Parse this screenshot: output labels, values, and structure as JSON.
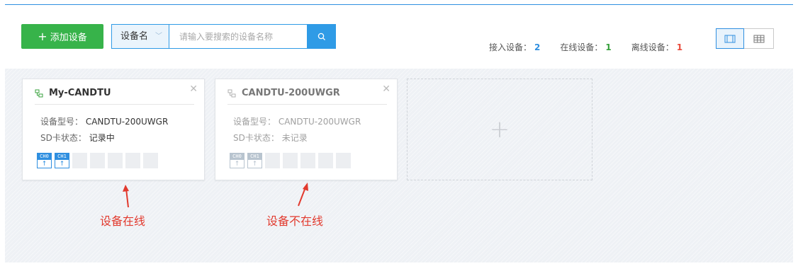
{
  "toolbar": {
    "add_label": "添加设备",
    "search_type": "设备名",
    "search_placeholder": "请输入要搜索的设备名称"
  },
  "stats": {
    "connected_label": "接入设备：",
    "connected": "2",
    "online_label": "在线设备：",
    "online": "1",
    "offline_label": "离线设备：",
    "offline": "1"
  },
  "devices": [
    {
      "name": "My-CANDTU",
      "model_label": "设备型号：",
      "model": "CANDTU-200UWGR",
      "sd_label": "SD卡状态：",
      "sd": "记录中",
      "status": "online",
      "channels": [
        "CH0",
        "CH1"
      ]
    },
    {
      "name": "CANDTU-200UWGR",
      "model_label": "设备型号：",
      "model": "CANDTU-200UWGR",
      "sd_label": "SD卡状态：",
      "sd": "未记录",
      "status": "offline",
      "channels": [
        "CH0",
        "CH1"
      ]
    }
  ],
  "annotations": {
    "online": "设备在线",
    "offline": "设备不在线"
  },
  "colors": {
    "accent_blue": "#2f8fe0",
    "add_green": "#37b34a",
    "annotation_red": "#e23a2e",
    "stat_green": "#37a13c",
    "stat_red": "#e94b3c"
  },
  "icons": [
    "plus-icon",
    "chevron-down-icon",
    "search-icon",
    "card-view-icon",
    "table-view-icon",
    "device-network-icon",
    "close-icon",
    "channel-upload-icon",
    "add-device-plus-icon",
    "annotation-arrow-icon"
  ]
}
